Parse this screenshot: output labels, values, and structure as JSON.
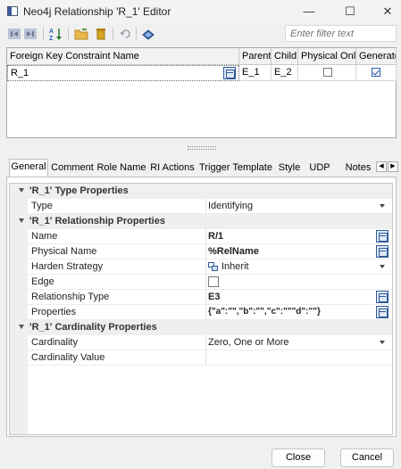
{
  "window": {
    "title": "Neo4j Relationship 'R_1' Editor",
    "minimize": "—",
    "maximize": "☐",
    "close": "✕"
  },
  "toolbar": {
    "filter_placeholder": "Enter filter text"
  },
  "grid": {
    "headers": [
      "Foreign Key Constraint Name",
      "Parent",
      "Child",
      "Physical Only",
      "Generate"
    ],
    "rows": [
      {
        "name": "R_1",
        "parent": "E_1",
        "child": "E_2",
        "physical_only": false,
        "generate": true
      }
    ]
  },
  "tabs": [
    "General",
    "Comment",
    "Role Name",
    "RI Actions",
    "Trigger Template",
    "Style",
    "UDP",
    "Notes"
  ],
  "active_tab": "General",
  "props": {
    "cat1": "'R_1' Type Properties",
    "type_name": "Type",
    "type_value": "Identifying",
    "cat2": "'R_1' Relationship Properties",
    "name_name": "Name",
    "name_value": "R/1",
    "phys_name": "Physical Name",
    "phys_value": "%RelName",
    "harden_name": "Harden Strategy",
    "harden_value": "Inherit",
    "edge_name": "Edge",
    "reltype_name": "Relationship Type",
    "reltype_value": "E3",
    "properties_name": "Properties",
    "properties_value": "{\"a\":\"\",\"b\":\"\",\"c\":\"\"\"d\":\"\"}",
    "cat3": "'R_1' Cardinality Properties",
    "card_name": "Cardinality",
    "card_value": "Zero, One or More",
    "cardval_name": "Cardinality Value"
  },
  "buttons": {
    "close": "Close",
    "cancel": "Cancel"
  }
}
